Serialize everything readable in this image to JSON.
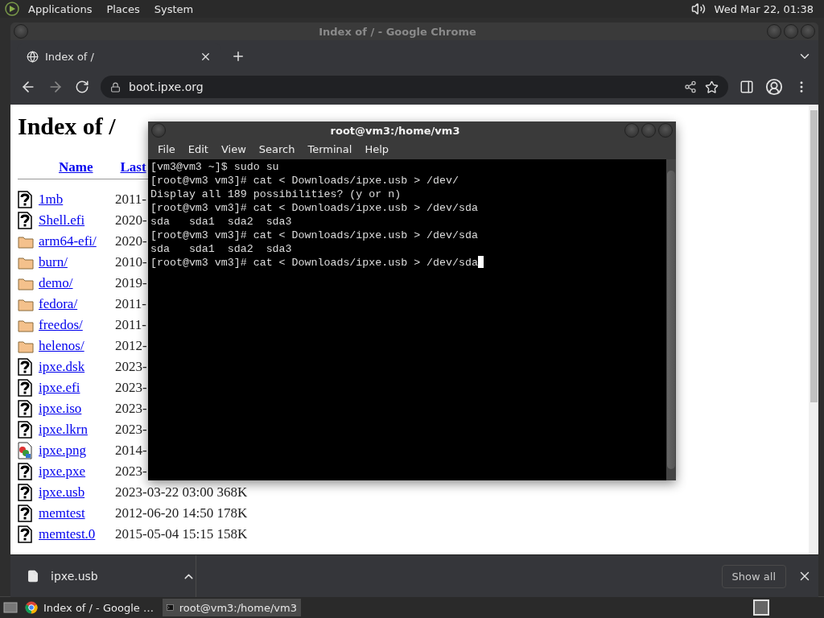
{
  "top_panel": {
    "menus": [
      "Applications",
      "Places",
      "System"
    ],
    "clock": "Wed Mar 22, 01:38"
  },
  "browser": {
    "title": "Index of / - Google Chrome",
    "tabs": [
      {
        "label": "Index of /",
        "selected": true
      }
    ],
    "url": "boot.ipxe.org",
    "page": {
      "heading": "Index of /",
      "columns": [
        "Name",
        "Last"
      ],
      "rows": [
        {
          "kind": "file",
          "name": "1mb",
          "info": "2011-"
        },
        {
          "kind": "file",
          "name": "Shell.efi",
          "info": "2020-"
        },
        {
          "kind": "folder",
          "name": "arm64-efi/",
          "info": "2020-"
        },
        {
          "kind": "folder",
          "name": "burn/",
          "info": "2010-"
        },
        {
          "kind": "folder",
          "name": "demo/",
          "info": "2019-"
        },
        {
          "kind": "folder",
          "name": "fedora/",
          "info": "2011-"
        },
        {
          "kind": "folder",
          "name": "freedos/",
          "info": "2011-"
        },
        {
          "kind": "folder",
          "name": "helenos/",
          "info": "2012-"
        },
        {
          "kind": "file",
          "name": "ipxe.dsk",
          "info": "2023-"
        },
        {
          "kind": "file",
          "name": "ipxe.efi",
          "info": "2023-"
        },
        {
          "kind": "file",
          "name": "ipxe.iso",
          "info": "2023-"
        },
        {
          "kind": "file",
          "name": "ipxe.lkrn",
          "info": "2023-"
        },
        {
          "kind": "image",
          "name": "ipxe.png",
          "info": "2014-"
        },
        {
          "kind": "file",
          "name": "ipxe.pxe",
          "info": "2023-"
        },
        {
          "kind": "file",
          "name": "ipxe.usb",
          "info": "2023-03-22 03:00 368K"
        },
        {
          "kind": "file",
          "name": "memtest",
          "info": "2012-06-20 14:50 178K"
        },
        {
          "kind": "file",
          "name": "memtest.0",
          "info": "2015-05-04 15:15 158K"
        }
      ]
    },
    "download": {
      "file": "ipxe.usb",
      "show_all": "Show all"
    }
  },
  "terminal": {
    "title": "root@vm3:/home/vm3",
    "menus": [
      "File",
      "Edit",
      "View",
      "Search",
      "Terminal",
      "Help"
    ],
    "lines": [
      "[vm3@vm3 ~]$ sudo su",
      "[root@vm3 vm3]# cat < Downloads/ipxe.usb > /dev/",
      "Display all 189 possibilities? (y or n)",
      "[root@vm3 vm3]# cat < Downloads/ipxe.usb > /dev/sda",
      "sda   sda1  sda2  sda3",
      "[root@vm3 vm3]# cat < Downloads/ipxe.usb > /dev/sda",
      "sda   sda1  sda2  sda3",
      "[root@vm3 vm3]# cat < Downloads/ipxe.usb > /dev/sda"
    ]
  },
  "taskbar": {
    "items": [
      {
        "kind": "browser",
        "label": "Index of / - Google …",
        "selected": false
      },
      {
        "kind": "terminal",
        "label": "root@vm3:/home/vm3",
        "selected": true
      }
    ]
  }
}
